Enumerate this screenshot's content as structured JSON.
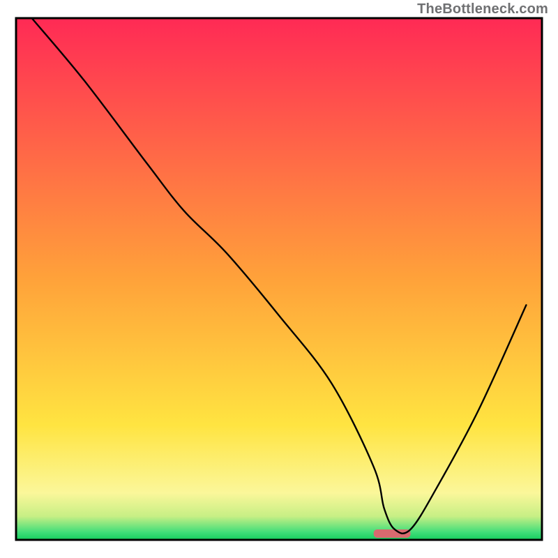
{
  "watermark": "TheBottleneck.com",
  "chart_data": {
    "type": "line",
    "title": "",
    "xlabel": "",
    "ylabel": "",
    "xlim": [
      0,
      100
    ],
    "ylim": [
      0,
      100
    ],
    "legend": false,
    "grid": false,
    "background_gradient": {
      "stops": [
        {
          "offset": 0.0,
          "color": "#ff2a55"
        },
        {
          "offset": 0.5,
          "color": "#ffa23a"
        },
        {
          "offset": 0.78,
          "color": "#ffe441"
        },
        {
          "offset": 0.91,
          "color": "#fbf79a"
        },
        {
          "offset": 0.955,
          "color": "#c7ef85"
        },
        {
          "offset": 0.985,
          "color": "#42de7a"
        },
        {
          "offset": 1.0,
          "color": "#15ce5e"
        }
      ]
    },
    "optimal_marker": {
      "x_start": 68,
      "x_end": 75,
      "y": 1.2,
      "color": "#d86a6f"
    },
    "series": [
      {
        "name": "bottleneck-curve",
        "color": "#000000",
        "x": [
          3,
          13,
          25,
          32,
          40,
          50,
          60,
          68,
          70,
          72,
          75,
          80,
          88,
          97
        ],
        "y": [
          100,
          88,
          72,
          63,
          55,
          43,
          30,
          14,
          6,
          2,
          2,
          10,
          25,
          45
        ]
      }
    ]
  }
}
